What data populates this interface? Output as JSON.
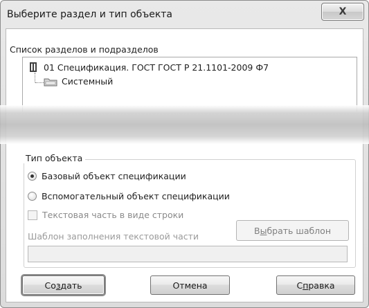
{
  "window": {
    "title": "Выберите раздел и тип объекта",
    "close_symbol": "X"
  },
  "sections": {
    "label": "Список разделов и подразделов",
    "tree": [
      {
        "label": "01 Спецификация. ГОСТ ГОСТ Р 21.1101-2009 Ф7",
        "icon": "book-icon"
      },
      {
        "label": "Системный",
        "icon": "folder-icon"
      }
    ]
  },
  "object_type": {
    "title": "Тип объекта",
    "options": [
      {
        "label": "Базовый объект спецификации",
        "selected": true
      },
      {
        "label": "Вспомогательный объект спецификации",
        "selected": false
      }
    ],
    "text_string_checkbox": "Текстовая часть в виде строки",
    "template_label": "Шаблон заполнения текстовой части",
    "choose_template_button": {
      "before": "В",
      "accel": "ы",
      "after": "брать шаблон"
    },
    "template_value": ""
  },
  "buttons": {
    "create": {
      "before": "Со",
      "accel": "з",
      "after": "дать"
    },
    "cancel": "Отмена",
    "help": {
      "before": "С",
      "accel": "п",
      "after": "равка"
    }
  }
}
